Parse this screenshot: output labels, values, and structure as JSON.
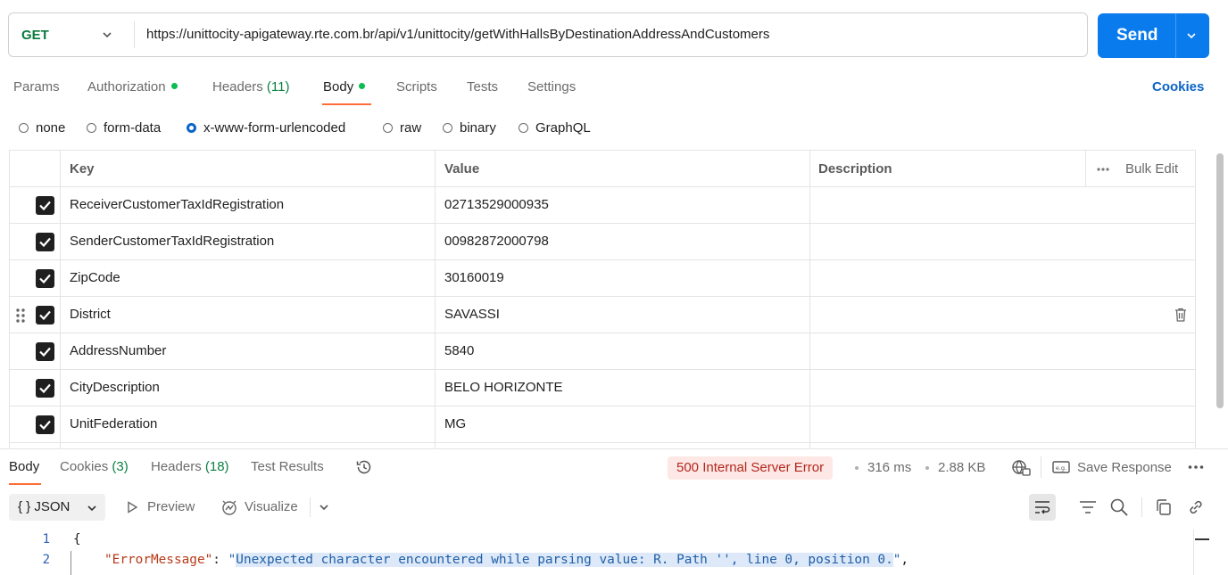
{
  "request": {
    "method": "GET",
    "url": "https://unittocity-apigateway.rte.com.br/api/v1/unittocity/getWithHallsByDestinationAddressAndCustomers",
    "send_label": "Send"
  },
  "tabs": [
    {
      "label": "Params"
    },
    {
      "label": "Authorization"
    },
    {
      "label": "Headers",
      "count": "(11)"
    },
    {
      "label": "Body"
    },
    {
      "label": "Scripts"
    },
    {
      "label": "Tests"
    },
    {
      "label": "Settings"
    }
  ],
  "cookies_label": "Cookies",
  "body_types": [
    "none",
    "form-data",
    "x-www-form-urlencoded",
    "raw",
    "binary",
    "GraphQL"
  ],
  "selected_body_type": "x-www-form-urlencoded",
  "table": {
    "headers": {
      "key": "Key",
      "value": "Value",
      "description": "Description",
      "bulk_edit": "Bulk Edit"
    },
    "rows": [
      {
        "key": "ReceiverCustomerTaxIdRegistration",
        "value": "02713529000935"
      },
      {
        "key": "SenderCustomerTaxIdRegistration",
        "value": "00982872000798"
      },
      {
        "key": "ZipCode",
        "value": "30160019"
      },
      {
        "key": "District",
        "value": "SAVASSI"
      },
      {
        "key": "AddressNumber",
        "value": "5840"
      },
      {
        "key": "CityDescription",
        "value": "BELO HORIZONTE"
      },
      {
        "key": "UnitFederation",
        "value": "MG"
      }
    ]
  },
  "response": {
    "tabs": [
      {
        "label": "Body"
      },
      {
        "label": "Cookies",
        "count": "(3)"
      },
      {
        "label": "Headers",
        "count": "(18)"
      },
      {
        "label": "Test Results"
      }
    ],
    "status": "500 Internal Server Error",
    "time": "316 ms",
    "size": "2.88 KB",
    "save_label": "Save Response",
    "format": "JSON",
    "preview_label": "Preview",
    "visualize_label": "Visualize",
    "code": {
      "line1_no": "1",
      "line2_no": "2",
      "line1": "{",
      "line2_key": "\"ErrorMessage\"",
      "line2_colon": ": ",
      "line2_value_open": "\"",
      "line2_value_text": "Unexpected character encountered while parsing value: R. Path '', line 0, position 0.",
      "line2_value_close": "\"",
      "line2_comma": ","
    }
  },
  "colors": {
    "send": "#097bed",
    "accent": "#ff6c37",
    "status_error_bg": "#fde8e5",
    "status_error_text": "#b3261e",
    "method": "#0b7a3e"
  }
}
